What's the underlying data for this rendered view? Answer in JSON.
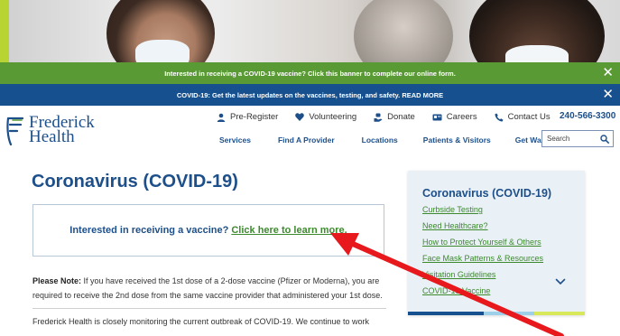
{
  "banners": {
    "green_text": "Interested in receiving a COVID-19 vaccine? Click this banner to complete our online form.",
    "blue_text": "COVID-19: Get the latest updates on the vaccines, testing, and safety. READ MORE",
    "close_glyph": "✕"
  },
  "header": {
    "logo_line1": "Frederick",
    "logo_line2": "Health",
    "phone": "240-566-3300",
    "top_nav": [
      "Pre-Register",
      "Volunteering",
      "Donate",
      "Careers",
      "Contact Us"
    ],
    "main_nav": [
      "Services",
      "Find A Provider",
      "Locations",
      "Patients & Visitors",
      "Get Walk-In Care"
    ],
    "search_placeholder": "Search"
  },
  "content": {
    "title": "Coronavirus (COVID-19)",
    "vaccine_prompt": "Interested in receiving a vaccine?",
    "vaccine_link": "Click here to learn more.",
    "note_label": "Please Note:",
    "note_text": " If you have received the 1st dose of a 2-dose vaccine (Pfizer or Moderna), you are required to receive the 2nd dose from the same vaccine provider that administered your 1st dose.",
    "paragraph": "Frederick Health is closely monitoring the current outbreak of COVID-19. We continue to work"
  },
  "sidebar": {
    "title": "Coronavirus (COVID-19)",
    "links": [
      "Curbside Testing",
      "Need Healthcare?",
      "How to Protect Yourself & Others",
      "Face Mask Patterns & Resources",
      "Visitation Guidelines",
      "COVID-19 Vaccine"
    ]
  },
  "colors": {
    "brand_blue": "#1d4f8a",
    "banner_green": "#5a9a35",
    "banner_blue": "#16508e",
    "link_green": "#3d8a2e",
    "annotation_red": "#e8191c"
  },
  "icons": {
    "pre_register": "person-icon",
    "volunteering": "heart-icon",
    "donate": "hand-icon",
    "careers": "id-card-icon",
    "contact": "phone-icon",
    "search": "search-icon",
    "sidebar_expand": "chevron-down-icon"
  }
}
